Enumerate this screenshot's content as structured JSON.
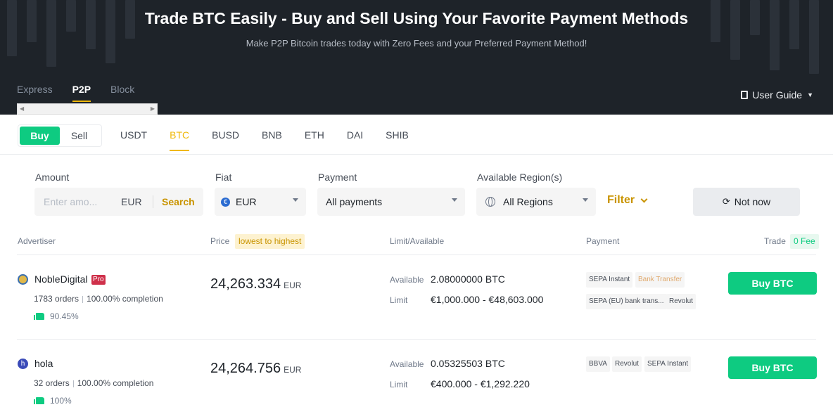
{
  "hero": {
    "title": "Trade BTC Easily - Buy and Sell Using Your Favorite Payment Methods",
    "subtitle": "Make P2P Bitcoin trades today with Zero Fees and your Preferred Payment Method!"
  },
  "mode_tabs": [
    "Express",
    "P2P",
    "Block"
  ],
  "user_guide": "User Guide",
  "trade_toggle": {
    "buy": "Buy",
    "sell": "Sell"
  },
  "coins": [
    "USDT",
    "BTC",
    "BUSD",
    "BNB",
    "ETH",
    "DAI",
    "SHIB"
  ],
  "filters": {
    "amount_label": "Amount",
    "amount_placeholder": "Enter amo...",
    "amount_currency": "EUR",
    "search": "Search",
    "fiat_label": "Fiat",
    "fiat_value": "EUR",
    "fiat_symbol": "€",
    "payment_label": "Payment",
    "payment_value": "All payments",
    "region_label": "Available Region(s)",
    "region_value": "All Regions",
    "filter": "Filter",
    "not_now": "Not now"
  },
  "table": {
    "headers": {
      "advertiser": "Advertiser",
      "price": "Price",
      "price_sort": "lowest to highest",
      "limit": "Limit/Available",
      "payment": "Payment",
      "trade": "Trade",
      "fee": "0 Fee"
    },
    "rows": [
      {
        "avatar": "",
        "name": "NobleDigital",
        "badge": "Pro",
        "orders": "1783 orders",
        "completion": "100.00% completion",
        "rating": "90.45%",
        "price": "24,263.334",
        "price_unit": "EUR",
        "available_label": "Available",
        "available": "2.08000000 BTC",
        "limit_label": "Limit",
        "limit": "€1,000.000 - €48,603.000",
        "payments": [
          "SEPA Instant",
          "Bank Transfer",
          "SEPA (EU) bank trans...",
          "Revolut"
        ],
        "action": "Buy BTC"
      },
      {
        "avatar": "h",
        "name": "hola",
        "orders": "32 orders",
        "completion": "100.00% completion",
        "rating": "100%",
        "price": "24,264.756",
        "price_unit": "EUR",
        "available_label": "Available",
        "available": "0.05325503 BTC",
        "limit_label": "Limit",
        "limit": "€400.000 - €1,292.220",
        "payments": [
          "BBVA",
          "Revolut",
          "SEPA Instant"
        ],
        "action": "Buy BTC"
      }
    ]
  },
  "colors": {
    "brand_yellow": "#f0b90b",
    "buy_green": "#0ecb81",
    "hero_bg": "#1e2329",
    "pro_red": "#cf304a"
  }
}
